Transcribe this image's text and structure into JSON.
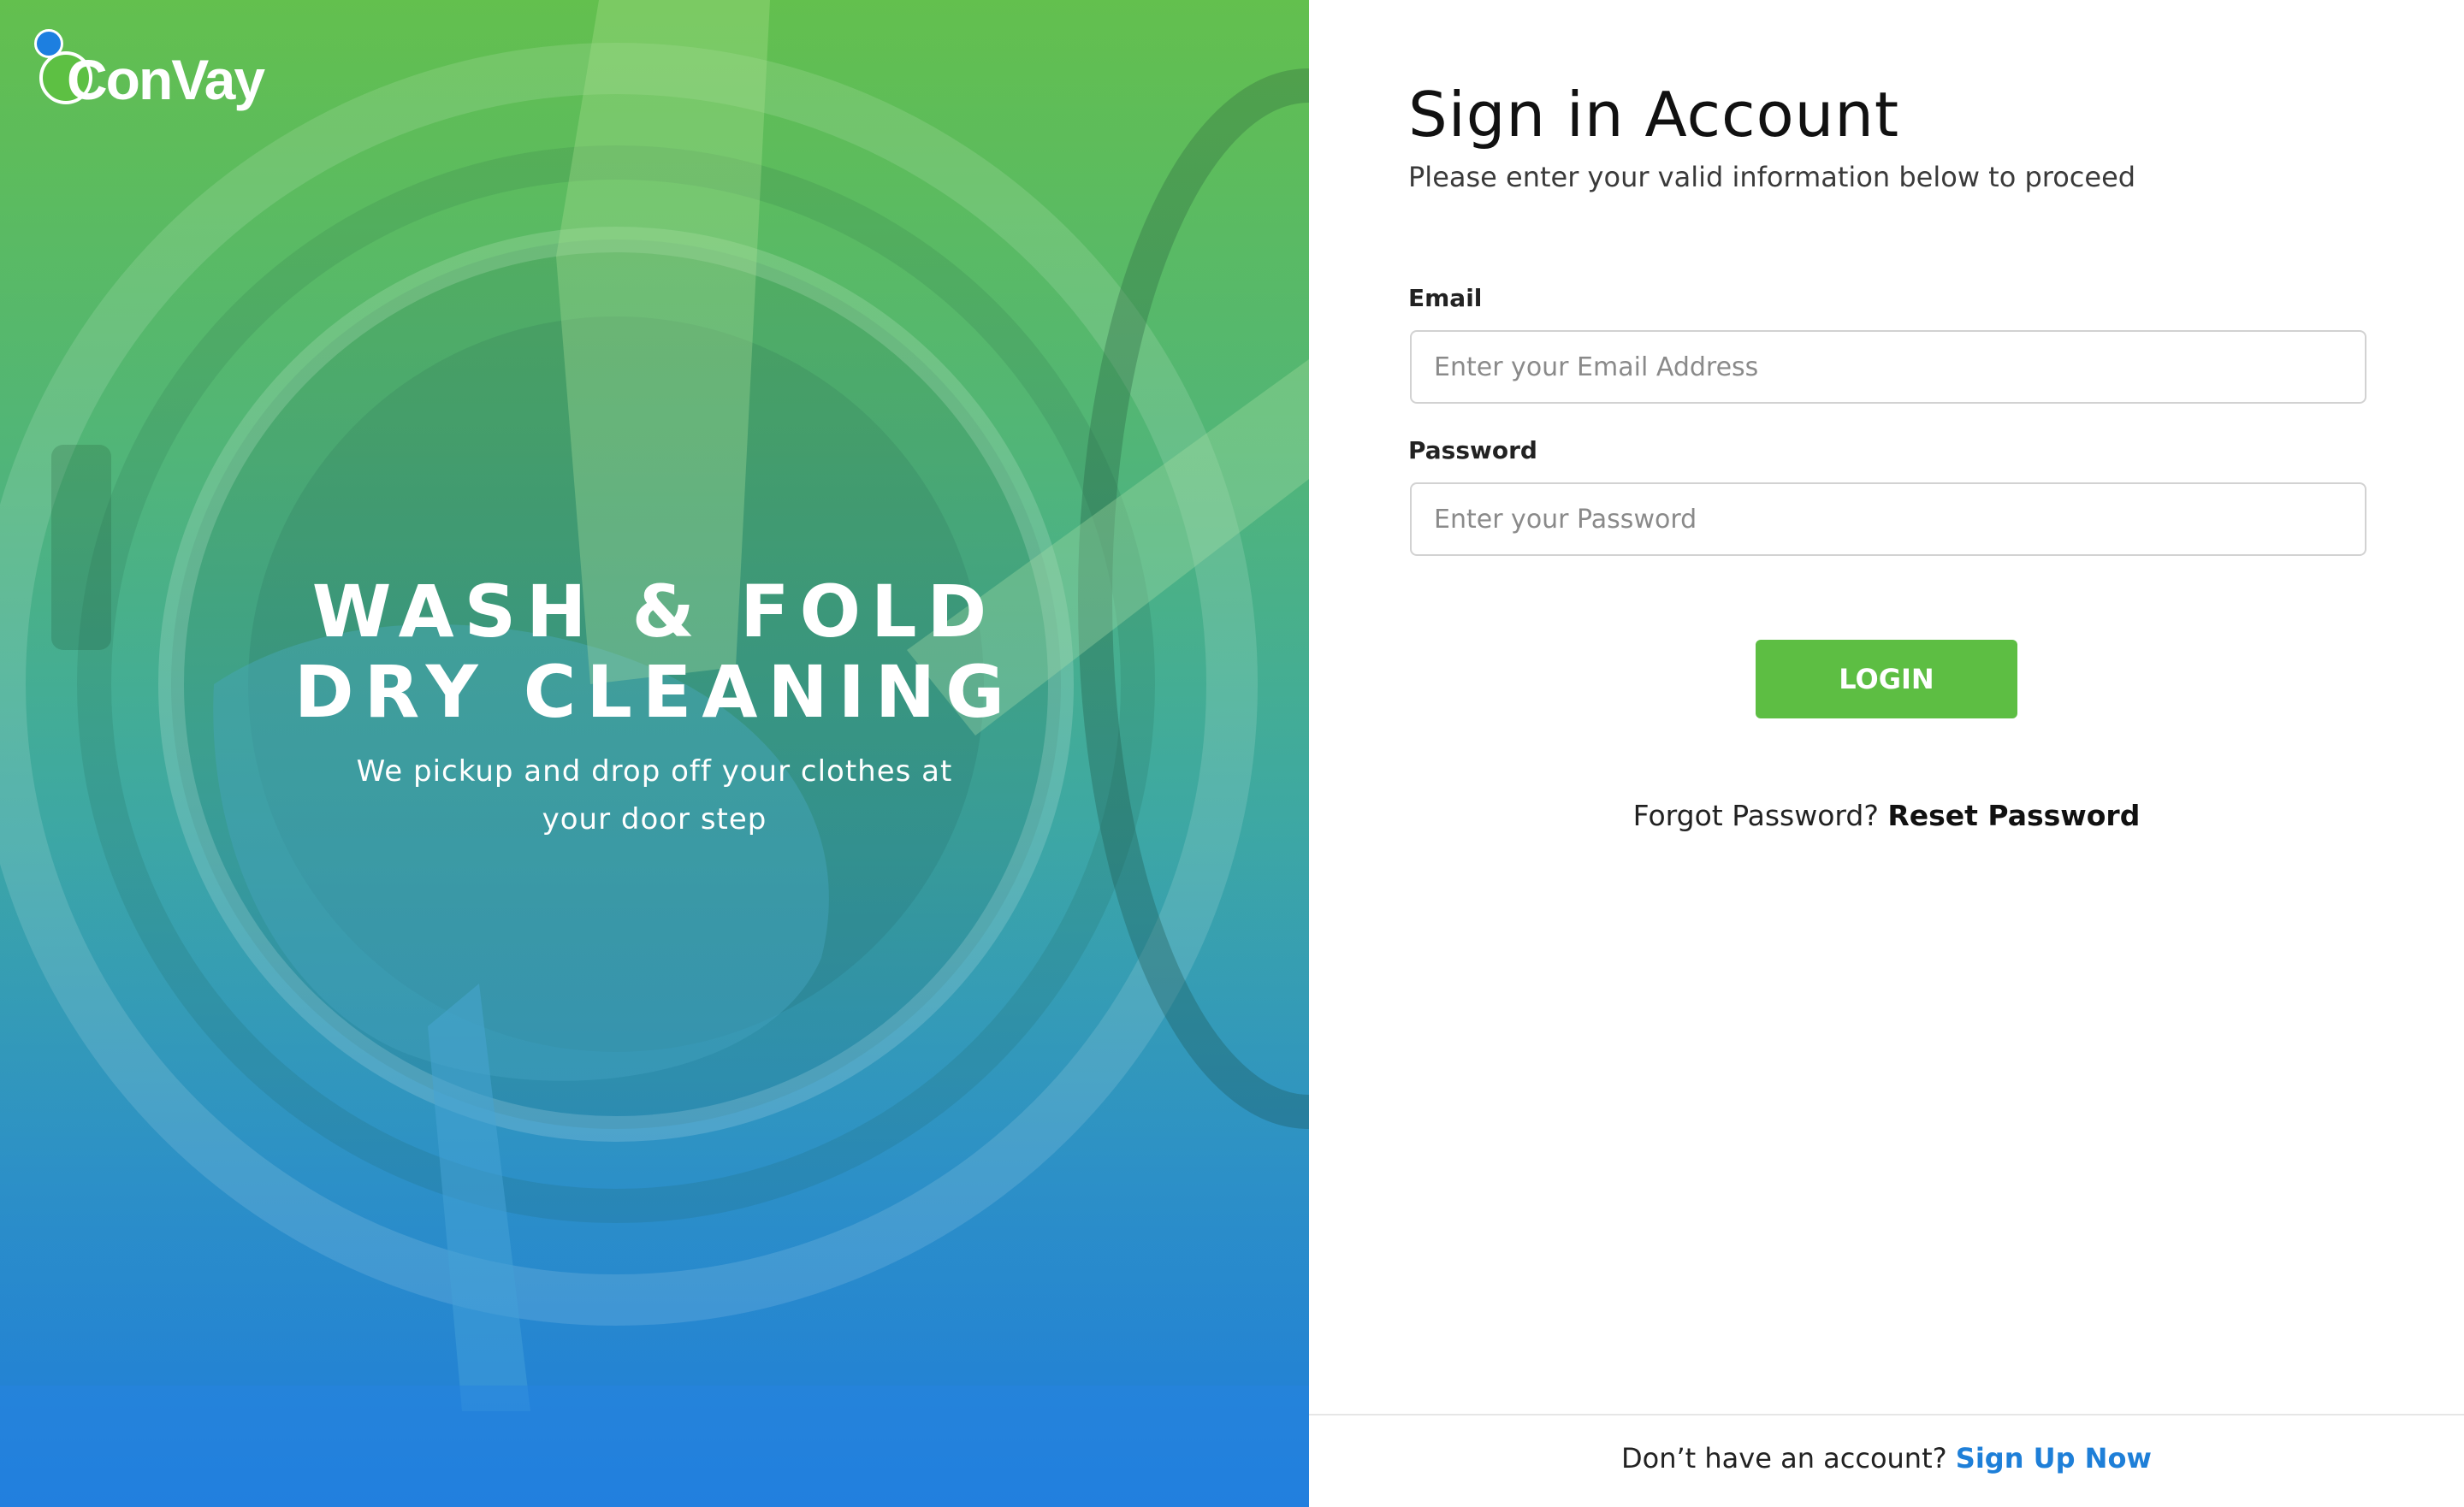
{
  "brand": {
    "name": "ConVay",
    "colors": {
      "accent_green": "#5dbe43",
      "accent_blue": "#1e7fd8"
    }
  },
  "hero": {
    "headline_line1": "WASH & FOLD",
    "headline_line2": "DRY CLEANING",
    "tagline": "We pickup and drop off your clothes at your door step",
    "background_icon": "washing-machine-photo"
  },
  "form": {
    "title": "Sign in Account",
    "subtitle": "Please enter your valid information below to proceed",
    "email": {
      "label": "Email",
      "placeholder": "Enter your Email Address",
      "value": ""
    },
    "password": {
      "label": "Password",
      "placeholder": "Enter your Password",
      "value": ""
    },
    "login_label": "LOGIN",
    "forgot_text": "Forgot Password?",
    "reset_link": "Reset Password"
  },
  "footer": {
    "prompt": "Don’t have an account?",
    "signup_link": "Sign Up Now"
  }
}
